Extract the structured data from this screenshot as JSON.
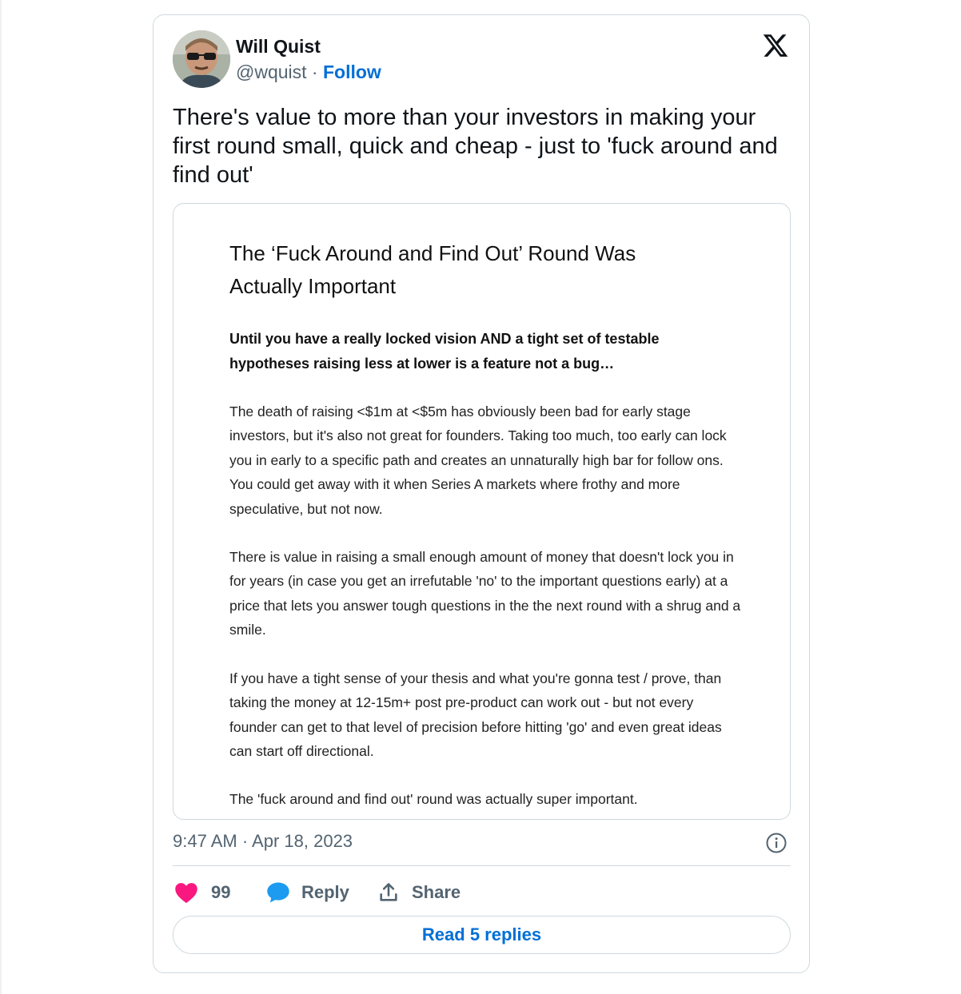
{
  "author": {
    "name": "Will Quist",
    "handle": "@wquist",
    "separator": " · ",
    "follow_label": "Follow"
  },
  "tweet": {
    "text": "There's value to more than your investors in making your first round small, quick and cheap - just to 'fuck around and find out'"
  },
  "article": {
    "title": "The ‘Fuck Around and Find Out’ Round Was Actually Important",
    "subtitle": "Until you have a really locked vision AND a tight set of testable hypotheses raising less at lower is a feature not a bug…",
    "paragraphs": [
      "The death of raising <$1m at <$5m has obviously been bad for early stage investors, but it's also not great for founders. Taking too much, too early can lock you in early to a specific path and creates an unnaturally high bar for follow ons. You could get away with it when Series A markets where frothy and more speculative, but not now.",
      "There is value in raising a small enough amount of money that doesn't lock you in for years (in case you get an irrefutable 'no' to the important questions early) at a price that lets you answer tough questions in the the next round with a shrug and a smile.",
      "If you have a tight sense of your thesis and what you're gonna test / prove, than taking the money at 12-15m+ post pre-product can work out - but not every founder can get to that level of precision before hitting 'go' and even great ideas can start off directional.",
      "The 'fuck around and find out' round was actually super important."
    ]
  },
  "meta": {
    "timestamp": "9:47 AM · Apr 18, 2023"
  },
  "actions": {
    "like_count": "99",
    "reply_label": "Reply",
    "share_label": "Share"
  },
  "footer": {
    "read_replies_label": "Read 5 replies"
  },
  "icons": {
    "like": "heart-icon",
    "reply": "speech-bubble-icon",
    "share": "share-arrow-icon",
    "info": "info-icon",
    "brand": "x-logo-icon"
  },
  "colors": {
    "like": "#f91880",
    "reply": "#1d9bf0",
    "link": "#006fd6",
    "muted": "#536471",
    "border": "#cfd9de"
  }
}
